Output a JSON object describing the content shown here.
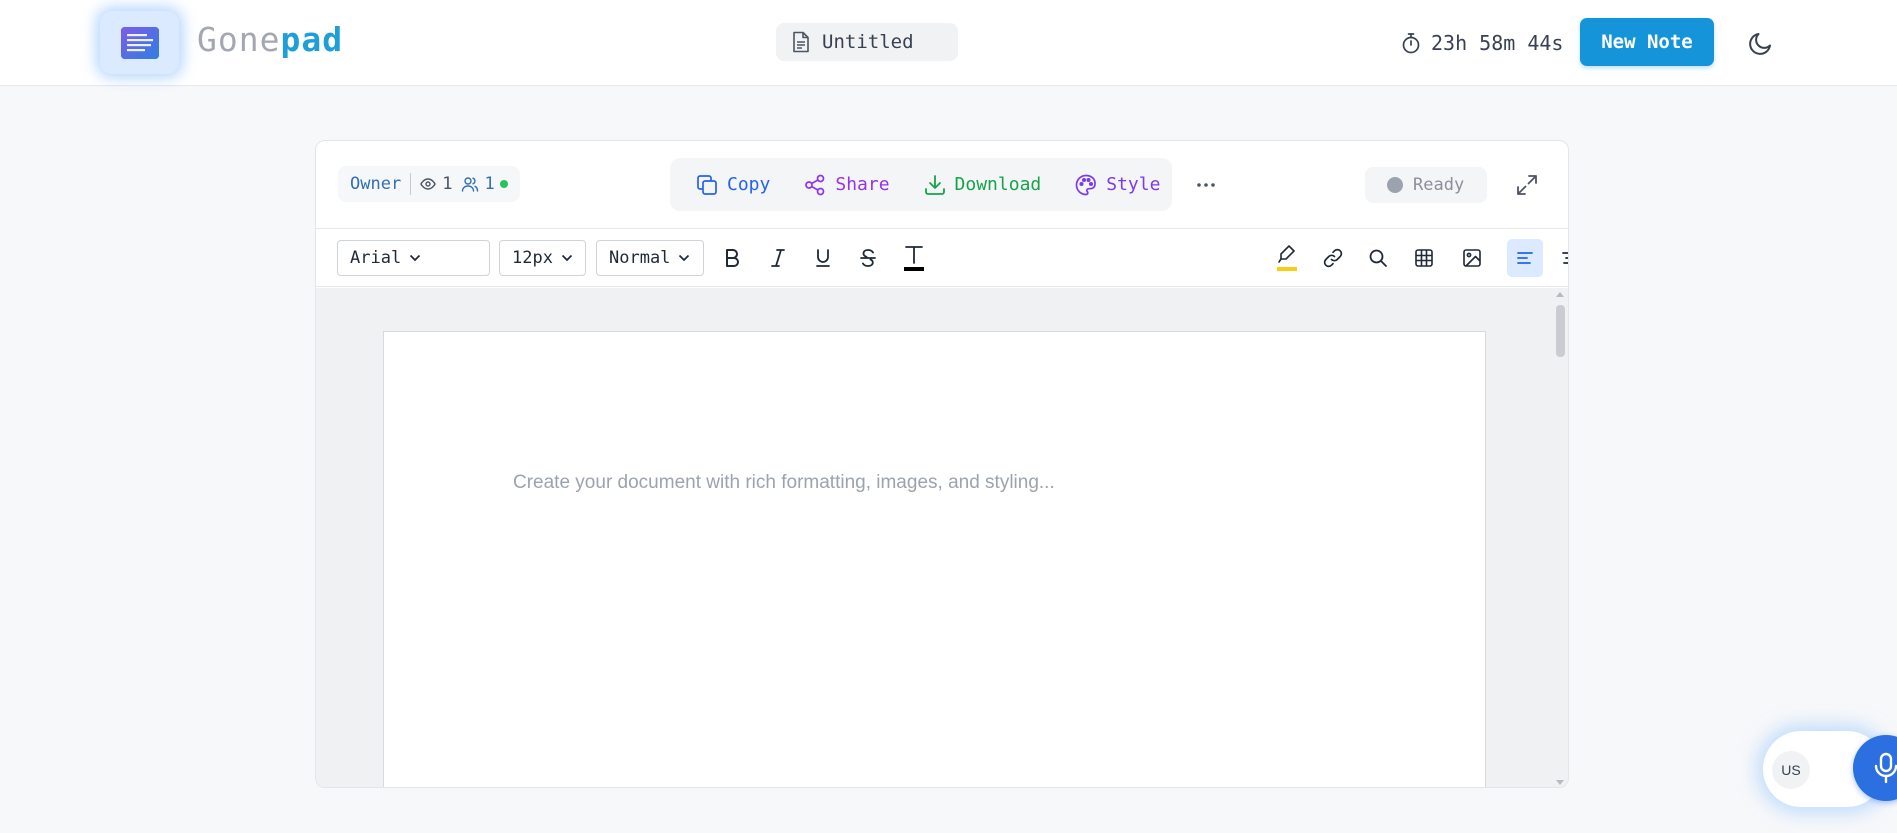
{
  "header": {
    "logo_part1": "Gone",
    "logo_part2": "pad",
    "doc_title": "Untitled",
    "timer": "23h 58m 44s",
    "new_note_label": "New Note"
  },
  "presence": {
    "owner_label": "Owner",
    "viewers": "1",
    "users": "1"
  },
  "actions": {
    "copy": "Copy",
    "share": "Share",
    "download": "Download",
    "style": "Style"
  },
  "status": "Ready",
  "format": {
    "font_family": "Arial",
    "font_size": "12px",
    "block_style": "Normal",
    "text_color": "#000000",
    "highlight_color": "#facc15",
    "alignment": "left"
  },
  "document": {
    "placeholder": "Create your document with rich formatting, images, and styling..."
  },
  "voice": {
    "lang": "US"
  },
  "colors": {
    "accent": "#1694d9",
    "copy": "#2563eb",
    "share": "#9333ea",
    "download": "#16a34a",
    "style": "#7c3aed",
    "online": "#22c55e"
  }
}
